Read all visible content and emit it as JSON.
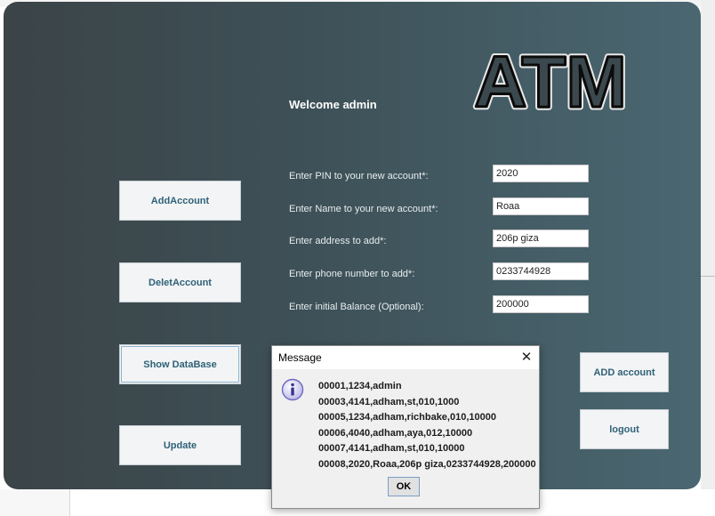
{
  "logo": {
    "text": "ATM"
  },
  "welcome": "Welcome admin",
  "form": {
    "fields": [
      {
        "label": "Enter PIN to your new account*:",
        "value": "2020"
      },
      {
        "label": "Enter Name to your new account*:",
        "value": "Roaa"
      },
      {
        "label": "Enter address to add*:",
        "value": "206p giza"
      },
      {
        "label": "Enter phone number to add*:",
        "value": "0233744928"
      },
      {
        "label": "Enter initial Balance (Optional):",
        "value": "200000"
      }
    ]
  },
  "left_buttons": {
    "add_account": "AddAccount",
    "delete_account": "DeletAccount",
    "show_database": "Show DataBase",
    "update": "Update"
  },
  "right_buttons": {
    "add": "ADD account",
    "logout": "logout"
  },
  "dialog": {
    "title": "Message",
    "close_glyph": "✕",
    "lines": [
      "00001,1234,admin",
      "00003,4141,adham,st,010,1000",
      "00005,1234,adham,richbake,010,10000",
      "00006,4040,adham,aya,012,10000",
      "00007,4141,adham,st,010,10000",
      "00008,2020,Roaa,206p giza,0233744928,200000"
    ],
    "ok": "OK",
    "icon": "info-icon"
  }
}
